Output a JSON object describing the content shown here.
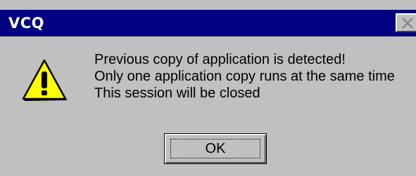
{
  "window": {
    "title": "VCQ",
    "close_icon": "close-icon",
    "titlebar_color": "#000080",
    "face_color": "#c0c0c0"
  },
  "content": {
    "icon": "warning-icon",
    "lines": [
      "Previous copy of application is detected!",
      "Only one application copy runs at the same time",
      "This session will be closed"
    ]
  },
  "buttons": {
    "ok_label": "OK"
  }
}
